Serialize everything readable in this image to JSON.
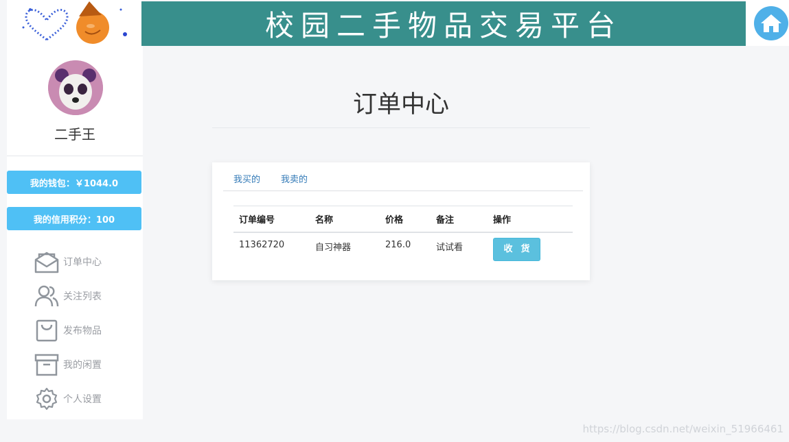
{
  "header": {
    "title": "校园二手物品交易平台",
    "banner_color": "#388f8c"
  },
  "sidebar": {
    "username": "二手王",
    "wallet": "我的钱包：￥1044.0",
    "credit": "我的信用积分：100",
    "pill_color": "#4fc0f5",
    "items": [
      {
        "label": "订单中心",
        "icon": "envelope-icon"
      },
      {
        "label": "关注列表",
        "icon": "users-icon"
      },
      {
        "label": "发布物品",
        "icon": "bag-icon"
      },
      {
        "label": "我的闲置",
        "icon": "archive-icon"
      },
      {
        "label": "个人设置",
        "icon": "gear-icon"
      }
    ]
  },
  "main": {
    "title": "订单中心",
    "tabs": [
      "我买的",
      "我卖的"
    ],
    "table": {
      "headers": [
        "订单编号",
        "名称",
        "价格",
        "备注",
        "操作"
      ],
      "rows": [
        {
          "order_no": "11362720",
          "name": "自习神器",
          "price": "216.0",
          "note": "试试看",
          "action": "收货"
        }
      ]
    }
  },
  "watermark": "https://blog.csdn.net/weixin_51966461"
}
